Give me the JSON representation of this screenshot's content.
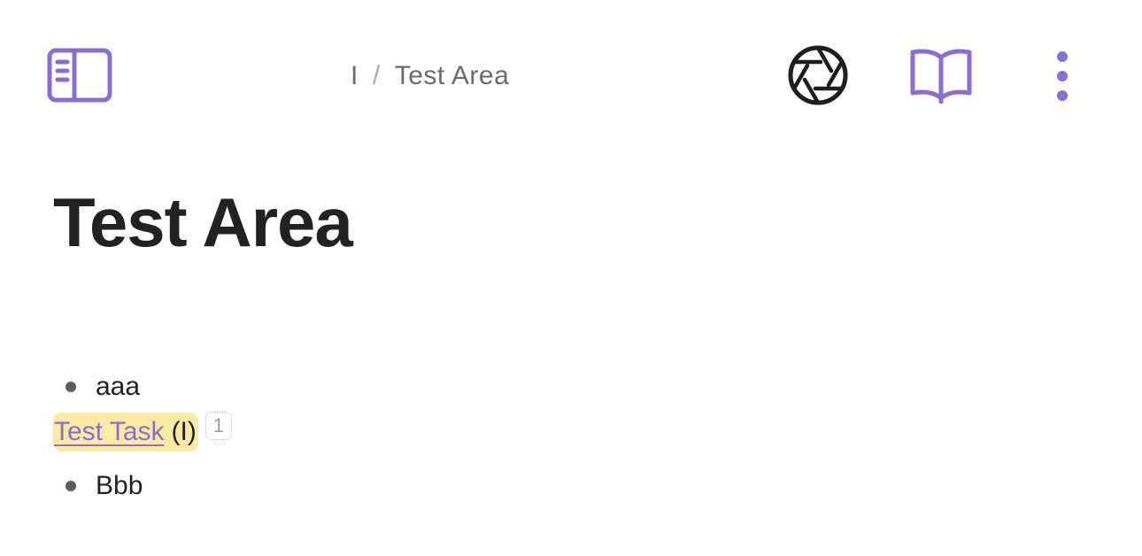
{
  "topbar": {
    "breadcrumb": {
      "parent": "I",
      "separator": "/",
      "current": "Test Area"
    },
    "icons": {
      "sidebar_toggle": "sidebar-toggle-icon",
      "camera": "camera-aperture-icon",
      "reader": "book-open-icon",
      "more": "more-vertical-icon"
    },
    "accent_color": "#8b6fd0"
  },
  "page": {
    "title": "Test Area",
    "items": [
      {
        "text": "aaa"
      },
      {
        "text": "Bbb"
      }
    ],
    "task": {
      "link_text": "Test Task",
      "paren_text": "(I)",
      "count": "1",
      "highlight_color": "#fbeaa3"
    }
  }
}
